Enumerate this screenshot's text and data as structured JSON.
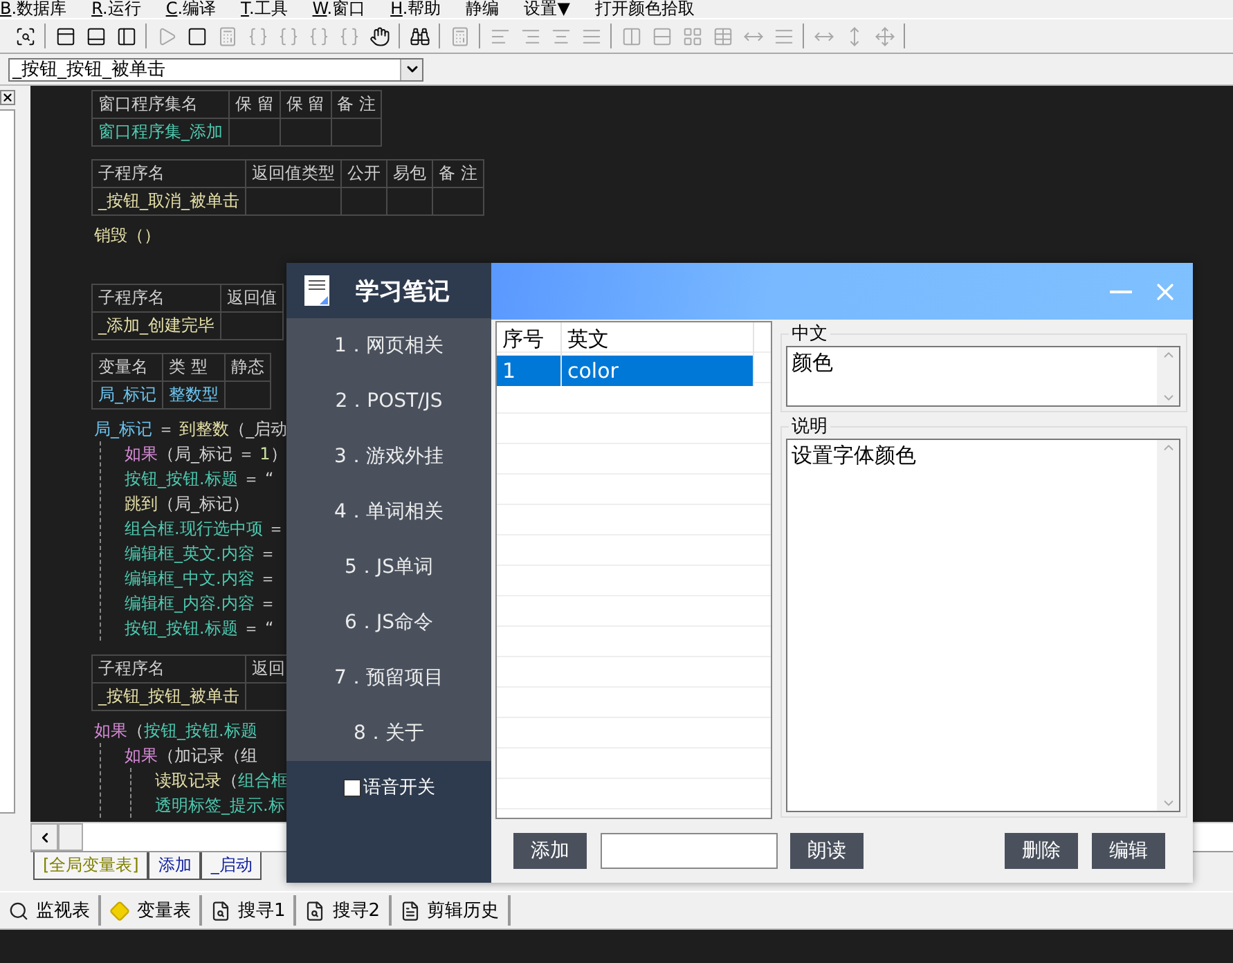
{
  "menu": [
    {
      "hotkey": "B",
      "label": ".数据库"
    },
    {
      "hotkey": "R",
      "label": ".运行"
    },
    {
      "hotkey": "C",
      "label": ".编译"
    },
    {
      "hotkey": "T",
      "label": ".工具"
    },
    {
      "hotkey": "W",
      "label": ".窗口"
    },
    {
      "hotkey": "H",
      "label": ".帮助"
    },
    {
      "label": "静编"
    },
    {
      "label": "设置▼"
    },
    {
      "label": "打开颜色拾取"
    }
  ],
  "toolbar": [
    [
      {
        "disabled": false
      }
    ],
    [
      {
        "disabled": false
      },
      {
        "disabled": false
      },
      {
        "disabled": false
      }
    ],
    [
      {
        "disabled": true
      },
      {
        "disabled": false
      },
      {
        "disabled": true
      },
      {
        "disabled": true
      },
      {
        "disabled": true
      },
      {
        "disabled": true
      },
      {
        "disabled": true
      },
      {
        "disabled": false
      }
    ],
    [
      {
        "disabled": false
      }
    ],
    [
      {
        "disabled": true
      }
    ],
    [
      {
        "disabled": true
      },
      {
        "disabled": true
      },
      {
        "disabled": true
      },
      {
        "disabled": true
      }
    ],
    [
      {
        "disabled": true
      },
      {
        "disabled": true
      },
      {
        "disabled": true
      },
      {
        "disabled": true
      },
      {
        "disabled": true
      },
      {
        "disabled": true
      }
    ],
    [
      {
        "disabled": true
      },
      {
        "disabled": true
      },
      {
        "disabled": true
      }
    ]
  ],
  "subroutine_select": {
    "value": "_按钮_按钮_被单击"
  },
  "code": [
    {
      "kind": "table",
      "columns": [
        "窗口程序集名",
        "保 留",
        "保 留",
        "备 注"
      ],
      "row": [
        {
          "text": "窗口程序集_添加",
          "kind": "member"
        }
      ]
    },
    {
      "kind": "table",
      "columns": [
        "子程序名",
        "返回值类型",
        "公开",
        "易包",
        "备 注"
      ],
      "row": [
        {
          "text": "_按钮_取消_被单击",
          "kind": "command"
        }
      ]
    },
    {
      "kind": "lines",
      "lines": [
        {
          "segments": [
            {
              "text": "销毁（）",
              "kind": "command"
            }
          ]
        }
      ]
    },
    {
      "kind": "gap"
    },
    {
      "kind": "table",
      "columns": [
        "子程序名",
        "返回值"
      ],
      "row": [
        {
          "text": "_添加_创建完毕",
          "kind": "command"
        }
      ]
    },
    {
      "kind": "table",
      "columns": [
        "变量名",
        "类 型",
        "静态"
      ],
      "row": [
        {
          "text": "局_标记",
          "kind": "variable"
        },
        {
          "text": "整数型",
          "kind": "variable"
        }
      ]
    },
    {
      "kind": "lines",
      "lines": [
        {
          "segments": [
            {
              "text": "局_标记",
              "kind": "variable"
            },
            {
              "text": " ＝ ",
              "kind": "plain"
            },
            {
              "text": "到整数",
              "kind": "command"
            },
            {
              "text": "（_启动",
              "kind": "plain"
            }
          ],
          "children": [
            {
              "segments": [
                {
                  "text": "如果",
                  "kind": "flow"
                },
                {
                  "text": "（局_标记 ＝ ",
                  "kind": "plain"
                },
                {
                  "text": "1",
                  "kind": "number"
                },
                {
                  "text": "）",
                  "kind": "plain"
                }
              ]
            },
            {
              "segments": [
                {
                  "text": "按钮_按钮.标题",
                  "kind": "member"
                },
                {
                  "text": " ＝ “",
                  "kind": "plain"
                }
              ]
            },
            {
              "segments": [
                {
                  "text": "跳到",
                  "kind": "command"
                },
                {
                  "text": "（局_标记）",
                  "kind": "plain"
                }
              ]
            },
            {
              "segments": [
                {
                  "text": "组合框.现行选中项",
                  "kind": "member"
                },
                {
                  "text": " ＝",
                  "kind": "plain"
                }
              ]
            },
            {
              "segments": [
                {
                  "text": "编辑框_英文.内容",
                  "kind": "member"
                },
                {
                  "text": " ＝",
                  "kind": "plain"
                }
              ]
            },
            {
              "segments": [
                {
                  "text": "编辑框_中文.内容",
                  "kind": "member"
                },
                {
                  "text": " ＝",
                  "kind": "plain"
                }
              ]
            },
            {
              "segments": [
                {
                  "text": "编辑框_内容.内容",
                  "kind": "member"
                },
                {
                  "text": " ＝",
                  "kind": "plain"
                }
              ]
            },
            {
              "segments": [
                {
                  "text": "按钮_按钮.标题",
                  "kind": "member"
                },
                {
                  "text": " ＝ “",
                  "kind": "plain"
                }
              ]
            }
          ]
        }
      ]
    },
    {
      "kind": "table",
      "columns": [
        "子程序名",
        "返回"
      ],
      "row": [
        {
          "text": "_按钮_按钮_被单击",
          "kind": "command"
        }
      ]
    },
    {
      "kind": "lines",
      "lines": [
        {
          "segments": [
            {
              "text": "如果",
              "kind": "flow"
            },
            {
              "text": "（",
              "kind": "plain"
            },
            {
              "text": "按钮_按钮.标题",
              "kind": "member"
            }
          ],
          "children": [
            {
              "segments": [
                {
                  "text": "如果",
                  "kind": "flow"
                },
                {
                  "text": "（加记录（组",
                  "kind": "plain"
                }
              ],
              "children": [
                {
                  "segments": [
                    {
                      "text": "读取记录",
                      "kind": "command"
                    },
                    {
                      "text": "（",
                      "kind": "plain"
                    },
                    {
                      "text": "组合框",
                      "kind": "member"
                    }
                  ]
                },
                {
                  "segments": [
                    {
                      "text": "透明标签_提示.标",
                      "kind": "member"
                    }
                  ]
                }
              ]
            }
          ]
        }
      ]
    }
  ],
  "code_tabs": [
    {
      "label": "[全局变量表]",
      "kind": "global"
    },
    {
      "label": "添加",
      "kind": "window"
    },
    {
      "label": "_启动",
      "kind": "window"
    }
  ],
  "bottom_tabs": [
    "监视表",
    "变量表",
    "搜寻1",
    "搜寻2",
    "剪辑历史"
  ],
  "dialog": {
    "app_name": "学习笔记",
    "nav": [
      "1．网页相关",
      "2．POST/JS",
      "3．游戏外挂",
      "4．单词相关",
      "5．JS单词",
      "6．JS命令",
      "7．预留项目",
      "8．关于"
    ],
    "voice_switch": {
      "label": "语音开关",
      "checked": false
    },
    "list": {
      "columns": [
        "序号",
        "英文"
      ],
      "rows": [
        {
          "cells": [
            "1",
            "color"
          ],
          "selected": true
        }
      ]
    },
    "chinese": {
      "label": "中文",
      "value": "颜色"
    },
    "description": {
      "label": "说明",
      "value": "设置字体颜色"
    },
    "buttons_left": [
      "添加"
    ],
    "buttons_middle": [
      "朗读"
    ],
    "buttons_right": [
      "删除",
      "编辑"
    ]
  }
}
